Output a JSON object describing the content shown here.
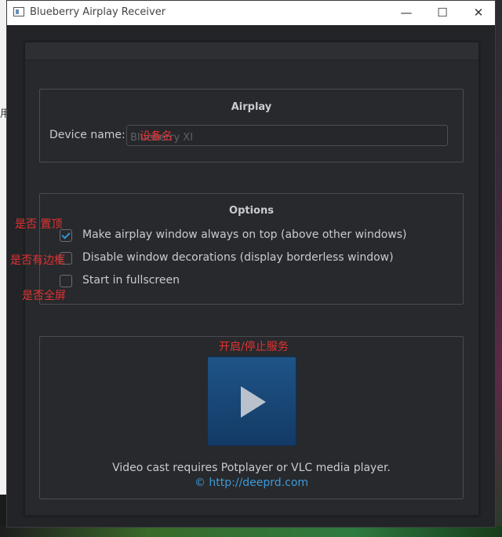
{
  "desktop": {
    "left_text": "用"
  },
  "window": {
    "title": "Blueberry Airplay Receiver",
    "buttons": {
      "minimize": "—",
      "maximize": "☐",
      "close": "✕"
    }
  },
  "airplay": {
    "title": "Airplay",
    "device_label": "Device name:",
    "device_placeholder": "Blueberry XI"
  },
  "options": {
    "title": "Options",
    "items": [
      {
        "label": "Make airplay window always on top (above other windows)",
        "checked": true
      },
      {
        "label": "Disable window decorations (display borderless window)",
        "checked": false
      },
      {
        "label": "Start in fullscreen",
        "checked": false
      }
    ]
  },
  "service": {
    "info": "Video cast requires Potplayer or VLC media player.",
    "link": "© http://deeprd.com"
  },
  "annotations": {
    "device": "设备名",
    "on_top": "是否 置顶",
    "borderless": "是否有边框",
    "fullscreen": "是否全屏",
    "service": "开启/停止服务"
  },
  "colors": {
    "accent": "#2f97d6",
    "annotation": "#e53232",
    "play_button": "#1e5487"
  }
}
